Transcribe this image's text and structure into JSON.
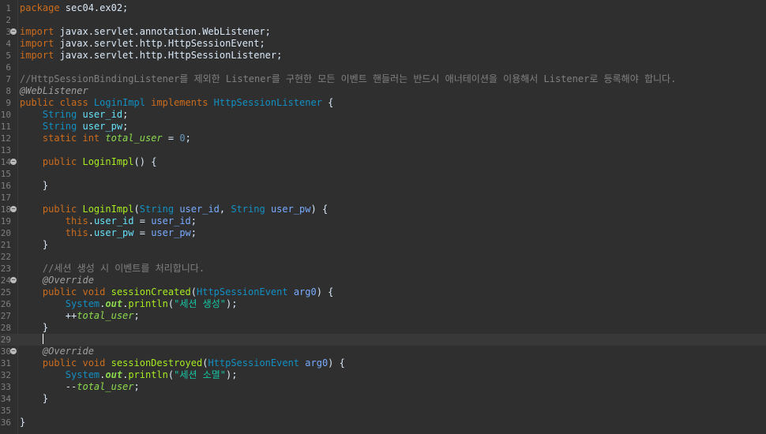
{
  "editor": {
    "current_line": 29,
    "lines": [
      {
        "n": "1",
        "fold": false,
        "tokens": [
          [
            "kw",
            "package "
          ],
          [
            "plain",
            "sec04.ex02;"
          ]
        ]
      },
      {
        "n": "2",
        "fold": false,
        "tokens": []
      },
      {
        "n": "3",
        "fold": true,
        "tokens": [
          [
            "kw",
            "import "
          ],
          [
            "plain",
            "javax.servlet.annotation.WebListener;"
          ]
        ]
      },
      {
        "n": "4",
        "fold": false,
        "tokens": [
          [
            "kw",
            "import "
          ],
          [
            "plain",
            "javax.servlet.http.HttpSessionEvent;"
          ]
        ]
      },
      {
        "n": "5",
        "fold": false,
        "tokens": [
          [
            "kw",
            "import "
          ],
          [
            "plain",
            "javax.servlet.http.HttpSessionListener;"
          ]
        ]
      },
      {
        "n": "6",
        "fold": false,
        "tokens": []
      },
      {
        "n": "7",
        "fold": false,
        "tokens": [
          [
            "comment",
            "//HttpSessionBindingListener를 제외한 Listener를 구현한 모든 이벤트 핸들러는 반드시 애너테이션을 이용해서 Listener로 등록해야 합니다."
          ]
        ]
      },
      {
        "n": "8",
        "fold": false,
        "tokens": [
          [
            "annot",
            "@WebListener"
          ]
        ]
      },
      {
        "n": "9",
        "fold": false,
        "tokens": [
          [
            "kw",
            "public class "
          ],
          [
            "class",
            "LoginImpl "
          ],
          [
            "kw",
            "implements "
          ],
          [
            "class",
            "HttpSessionListener "
          ],
          [
            "plain",
            "{"
          ]
        ]
      },
      {
        "n": "10",
        "fold": false,
        "tokens": [
          [
            "plain",
            "    "
          ],
          [
            "type",
            "String "
          ],
          [
            "field",
            "user_id"
          ],
          [
            "plain",
            ";"
          ]
        ]
      },
      {
        "n": "11",
        "fold": false,
        "tokens": [
          [
            "plain",
            "    "
          ],
          [
            "type",
            "String "
          ],
          [
            "field",
            "user_pw"
          ],
          [
            "plain",
            ";"
          ]
        ]
      },
      {
        "n": "12",
        "fold": false,
        "tokens": [
          [
            "plain",
            "    "
          ],
          [
            "kw",
            "static int "
          ],
          [
            "static",
            "total_user"
          ],
          [
            "plain",
            " = "
          ],
          [
            "num",
            "0"
          ],
          [
            "plain",
            ";"
          ]
        ]
      },
      {
        "n": "13",
        "fold": false,
        "tokens": []
      },
      {
        "n": "14",
        "fold": true,
        "tokens": [
          [
            "plain",
            "    "
          ],
          [
            "kw",
            "public "
          ],
          [
            "method",
            "LoginImpl"
          ],
          [
            "plain",
            "() {"
          ]
        ]
      },
      {
        "n": "15",
        "fold": false,
        "tokens": []
      },
      {
        "n": "16",
        "fold": false,
        "tokens": [
          [
            "plain",
            "    }"
          ]
        ]
      },
      {
        "n": "17",
        "fold": false,
        "tokens": []
      },
      {
        "n": "18",
        "fold": true,
        "tokens": [
          [
            "plain",
            "    "
          ],
          [
            "kw",
            "public "
          ],
          [
            "method",
            "LoginImpl"
          ],
          [
            "plain",
            "("
          ],
          [
            "type",
            "String "
          ],
          [
            "param",
            "user_id"
          ],
          [
            "plain",
            ", "
          ],
          [
            "type",
            "String "
          ],
          [
            "param",
            "user_pw"
          ],
          [
            "plain",
            ") {"
          ]
        ]
      },
      {
        "n": "19",
        "fold": false,
        "tokens": [
          [
            "plain",
            "        "
          ],
          [
            "kw",
            "this"
          ],
          [
            "plain",
            "."
          ],
          [
            "field",
            "user_id"
          ],
          [
            "plain",
            " = "
          ],
          [
            "param",
            "user_id"
          ],
          [
            "plain",
            ";"
          ]
        ]
      },
      {
        "n": "20",
        "fold": false,
        "tokens": [
          [
            "plain",
            "        "
          ],
          [
            "kw",
            "this"
          ],
          [
            "plain",
            "."
          ],
          [
            "field",
            "user_pw"
          ],
          [
            "plain",
            " = "
          ],
          [
            "param",
            "user_pw"
          ],
          [
            "plain",
            ";"
          ]
        ]
      },
      {
        "n": "21",
        "fold": false,
        "tokens": [
          [
            "plain",
            "    }"
          ]
        ]
      },
      {
        "n": "22",
        "fold": false,
        "tokens": []
      },
      {
        "n": "23",
        "fold": false,
        "tokens": [
          [
            "plain",
            "    "
          ],
          [
            "comment",
            "//세션 생성 시 이벤트를 처리합니다."
          ]
        ]
      },
      {
        "n": "24",
        "fold": true,
        "tokens": [
          [
            "plain",
            "    "
          ],
          [
            "annot",
            "@Override"
          ]
        ]
      },
      {
        "n": "25",
        "fold": false,
        "tokens": [
          [
            "plain",
            "    "
          ],
          [
            "kw",
            "public void "
          ],
          [
            "method",
            "sessionCreated"
          ],
          [
            "plain",
            "("
          ],
          [
            "class",
            "HttpSessionEvent "
          ],
          [
            "param",
            "arg0"
          ],
          [
            "plain",
            ") {"
          ]
        ]
      },
      {
        "n": "26",
        "fold": false,
        "tokens": [
          [
            "plain",
            "        "
          ],
          [
            "class",
            "System"
          ],
          [
            "plain",
            "."
          ],
          [
            "static-bold",
            "out"
          ],
          [
            "plain",
            "."
          ],
          [
            "method",
            "println"
          ],
          [
            "plain",
            "("
          ],
          [
            "string",
            "\"세션 생성\""
          ],
          [
            "plain",
            ");"
          ]
        ]
      },
      {
        "n": "27",
        "fold": false,
        "tokens": [
          [
            "plain",
            "        ++"
          ],
          [
            "static",
            "total_user"
          ],
          [
            "plain",
            ";"
          ]
        ]
      },
      {
        "n": "28",
        "fold": false,
        "tokens": [
          [
            "plain",
            "    }"
          ]
        ]
      },
      {
        "n": "29",
        "fold": false,
        "tokens": [
          [
            "plain",
            "    "
          ],
          [
            "cursor",
            ""
          ]
        ]
      },
      {
        "n": "30",
        "fold": true,
        "tokens": [
          [
            "plain",
            "    "
          ],
          [
            "annot",
            "@Override"
          ]
        ]
      },
      {
        "n": "31",
        "fold": false,
        "tokens": [
          [
            "plain",
            "    "
          ],
          [
            "kw",
            "public void "
          ],
          [
            "method",
            "sessionDestroyed"
          ],
          [
            "plain",
            "("
          ],
          [
            "class",
            "HttpSessionEvent "
          ],
          [
            "param",
            "arg0"
          ],
          [
            "plain",
            ") {"
          ]
        ]
      },
      {
        "n": "32",
        "fold": false,
        "tokens": [
          [
            "plain",
            "        "
          ],
          [
            "class",
            "System"
          ],
          [
            "plain",
            "."
          ],
          [
            "static-bold",
            "out"
          ],
          [
            "plain",
            "."
          ],
          [
            "method",
            "println"
          ],
          [
            "plain",
            "("
          ],
          [
            "string",
            "\"세션 소멸\""
          ],
          [
            "plain",
            ");"
          ]
        ]
      },
      {
        "n": "33",
        "fold": false,
        "tokens": [
          [
            "plain",
            "        --"
          ],
          [
            "static",
            "total_user"
          ],
          [
            "plain",
            ";"
          ]
        ]
      },
      {
        "n": "34",
        "fold": false,
        "tokens": [
          [
            "plain",
            "    }"
          ]
        ]
      },
      {
        "n": "35",
        "fold": false,
        "tokens": []
      },
      {
        "n": "36",
        "fold": false,
        "tokens": [
          [
            "plain",
            "}"
          ]
        ]
      }
    ]
  },
  "icons": {
    "fold": "collapse-fold-icon"
  },
  "colors": {
    "background": "#2f2f2f",
    "keyword": "#cc6c1d",
    "type": "#1290c3",
    "field": "#66e1f8",
    "static_field": "#8dda4f",
    "method": "#a7ec21",
    "string": "#17c6a3",
    "comment": "#808080",
    "annotation": "#a0a0a0"
  }
}
